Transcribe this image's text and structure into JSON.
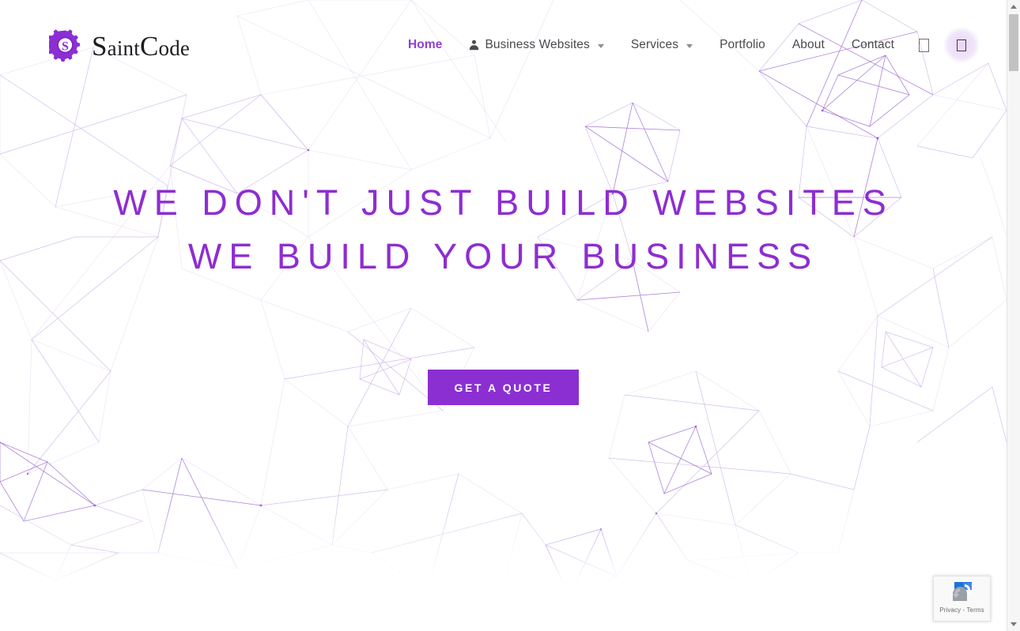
{
  "brand": {
    "name_part1": "S",
    "name_part2": "aint",
    "name_part3": "C",
    "name_part4": "ode",
    "full_name": "SaintCode",
    "mark_icon": "gear-circuit-logo-icon",
    "accent_color": "#8b2fd2"
  },
  "nav": {
    "items": [
      {
        "label": "Home",
        "active": true,
        "has_dropdown": false,
        "icon": null
      },
      {
        "label": "Business Websites",
        "active": false,
        "has_dropdown": true,
        "icon": "person-icon"
      },
      {
        "label": "Services",
        "active": false,
        "has_dropdown": true,
        "icon": null
      },
      {
        "label": "Portfolio",
        "active": false,
        "has_dropdown": false,
        "icon": null
      },
      {
        "label": "About",
        "active": false,
        "has_dropdown": false,
        "icon": null
      },
      {
        "label": "Contact",
        "active": false,
        "has_dropdown": false,
        "icon": null
      }
    ],
    "search_icon": "search-icon-missing-glyph",
    "menu_button_icon": "menu-icon-missing-glyph",
    "active_color": "#8f3fd4",
    "text_color": "#4a4a4f"
  },
  "hero": {
    "headline_line1": "WE DON'T JUST BUILD WEBSITES",
    "headline_line2": "WE BUILD YOUR BUSINESS",
    "headline_color": "#8e2dd0",
    "cta_label": "GET A QUOTE",
    "cta_bg": "#8b2fd2",
    "cta_text_color": "#ffffff",
    "background_style": "particle-network"
  },
  "recaptcha": {
    "privacy_label": "Privacy",
    "separator": "-",
    "terms_label": "Terms",
    "combined": "Privacy - Terms",
    "logo_icon": "recaptcha-logo-icon"
  },
  "scrollbar": {
    "up_icon": "scroll-up-arrow-icon",
    "down_icon": "scroll-down-arrow-icon",
    "thumb": "scrollbar-thumb"
  }
}
